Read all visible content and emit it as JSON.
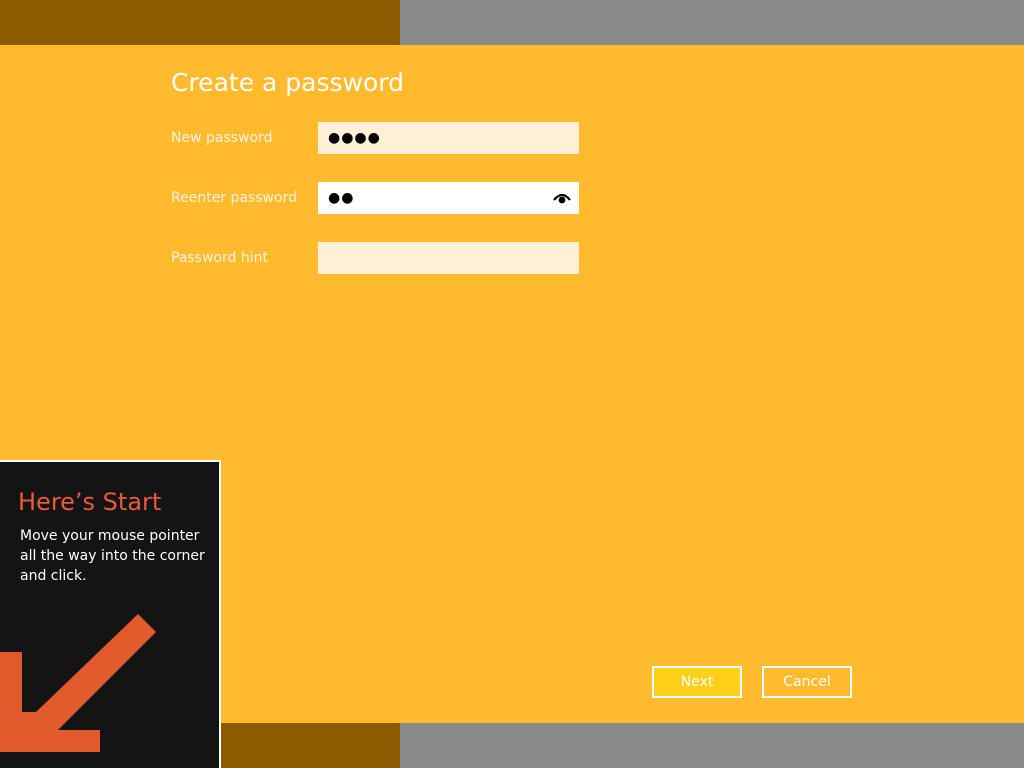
{
  "page": {
    "title": "Create a password"
  },
  "form": {
    "new_password": {
      "label": "New password",
      "masked_value": "●●●●"
    },
    "reenter_password": {
      "label": "Reenter password",
      "masked_value": "●●",
      "reveal_icon": "eye-icon"
    },
    "password_hint": {
      "label": "Password hint",
      "value": "",
      "placeholder": ""
    }
  },
  "buttons": {
    "next_label": "Next",
    "cancel_label": "Cancel"
  },
  "start_tip": {
    "title": "Here’s Start",
    "body": "Move your mouse pointer all the way into the corner and click.",
    "arrow_icon": "down-left-arrow-icon"
  },
  "colors": {
    "background": "#ffba2e",
    "band_dark": "#8b5b00",
    "band_gray": "#8a8a8a",
    "tip_background": "#141414",
    "tip_title": "#ec5a3a",
    "arrow": "#e05a2c",
    "primary_button": "#ffcf1a"
  }
}
